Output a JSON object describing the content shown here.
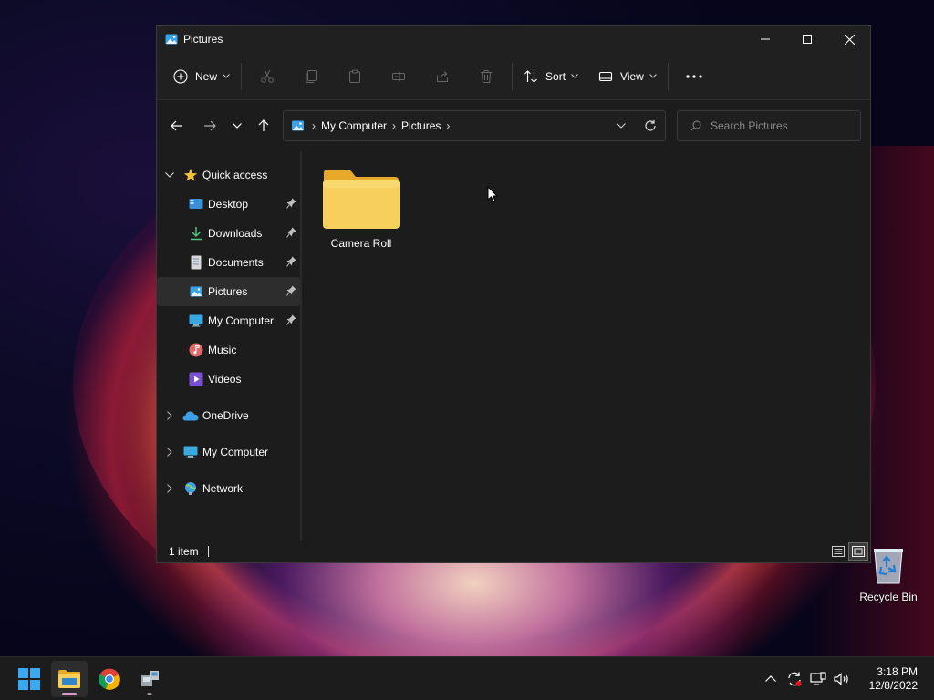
{
  "window": {
    "title": "Pictures",
    "controls": [
      "minimize",
      "maximize",
      "close"
    ]
  },
  "toolbar": {
    "new_label": "New",
    "sort_label": "Sort",
    "view_label": "View",
    "icons": [
      "cut-icon",
      "copy-icon",
      "paste-icon",
      "rename-icon",
      "share-icon",
      "delete-icon",
      "more-icon"
    ]
  },
  "address": {
    "crumbs": [
      "My Computer",
      "Pictures"
    ]
  },
  "search": {
    "placeholder": "Search Pictures"
  },
  "sidebar": {
    "quick_access": "Quick access",
    "items": [
      {
        "label": "Desktop",
        "icon": "desktop-icon",
        "pinned": true
      },
      {
        "label": "Downloads",
        "icon": "downloads-icon",
        "pinned": true
      },
      {
        "label": "Documents",
        "icon": "documents-icon",
        "pinned": true
      },
      {
        "label": "Pictures",
        "icon": "pictures-icon",
        "pinned": true,
        "active": true
      },
      {
        "label": "My Computer",
        "icon": "computer-icon",
        "pinned": true
      },
      {
        "label": "Music",
        "icon": "music-icon",
        "pinned": false
      },
      {
        "label": "Videos",
        "icon": "videos-icon",
        "pinned": false
      }
    ],
    "roots": [
      {
        "label": "OneDrive",
        "icon": "onedrive-icon"
      },
      {
        "label": "My Computer",
        "icon": "computer-icon"
      },
      {
        "label": "Network",
        "icon": "network-icon"
      }
    ]
  },
  "content": {
    "items": [
      {
        "label": "Camera Roll",
        "type": "folder"
      }
    ]
  },
  "status": {
    "count": "1 item"
  },
  "desktop": {
    "recycle_bin": "Recycle Bin"
  },
  "taskbar": {
    "time": "3:18 PM",
    "date": "12/8/2022"
  },
  "colors": {
    "folder": "#f4c64a",
    "accent": "#4fa3e0",
    "window_bg": "#1c1c1c"
  }
}
